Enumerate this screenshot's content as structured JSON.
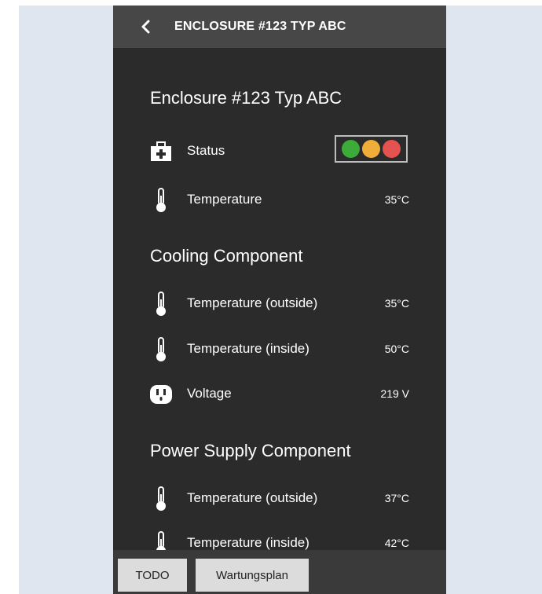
{
  "header": {
    "title": "ENCLOSURE #123 TYP ABC",
    "back_icon": "chevron-left-icon"
  },
  "sections": [
    {
      "title": "Enclosure #123 Typ ABC",
      "rows": [
        {
          "label": "Status",
          "icon": "first-aid-kit-icon",
          "value": ""
        },
        {
          "label": "Temperature",
          "icon": "thermometer-icon",
          "value": "35°C"
        }
      ]
    },
    {
      "title": "Cooling Component",
      "rows": [
        {
          "label": "Temperature (outside)",
          "icon": "thermometer-icon",
          "value": "35°C"
        },
        {
          "label": "Temperature (inside)",
          "icon": "thermometer-icon",
          "value": "50°C"
        },
        {
          "label": "Voltage",
          "icon": "power-outlet-icon",
          "value": "219 V"
        }
      ]
    },
    {
      "title": "Power Supply Component",
      "rows": [
        {
          "label": "Temperature (outside)",
          "icon": "thermometer-icon",
          "value": "37°C"
        },
        {
          "label": "Temperature (inside)",
          "icon": "thermometer-icon",
          "value": "42°C"
        }
      ]
    }
  ],
  "status_colors": {
    "green": "#3cab3a",
    "yellow": "#f0ad3a",
    "red": "#e4534f"
  },
  "footer": {
    "todo_label": "TODO",
    "maintenance_label": "Wartungsplan"
  }
}
